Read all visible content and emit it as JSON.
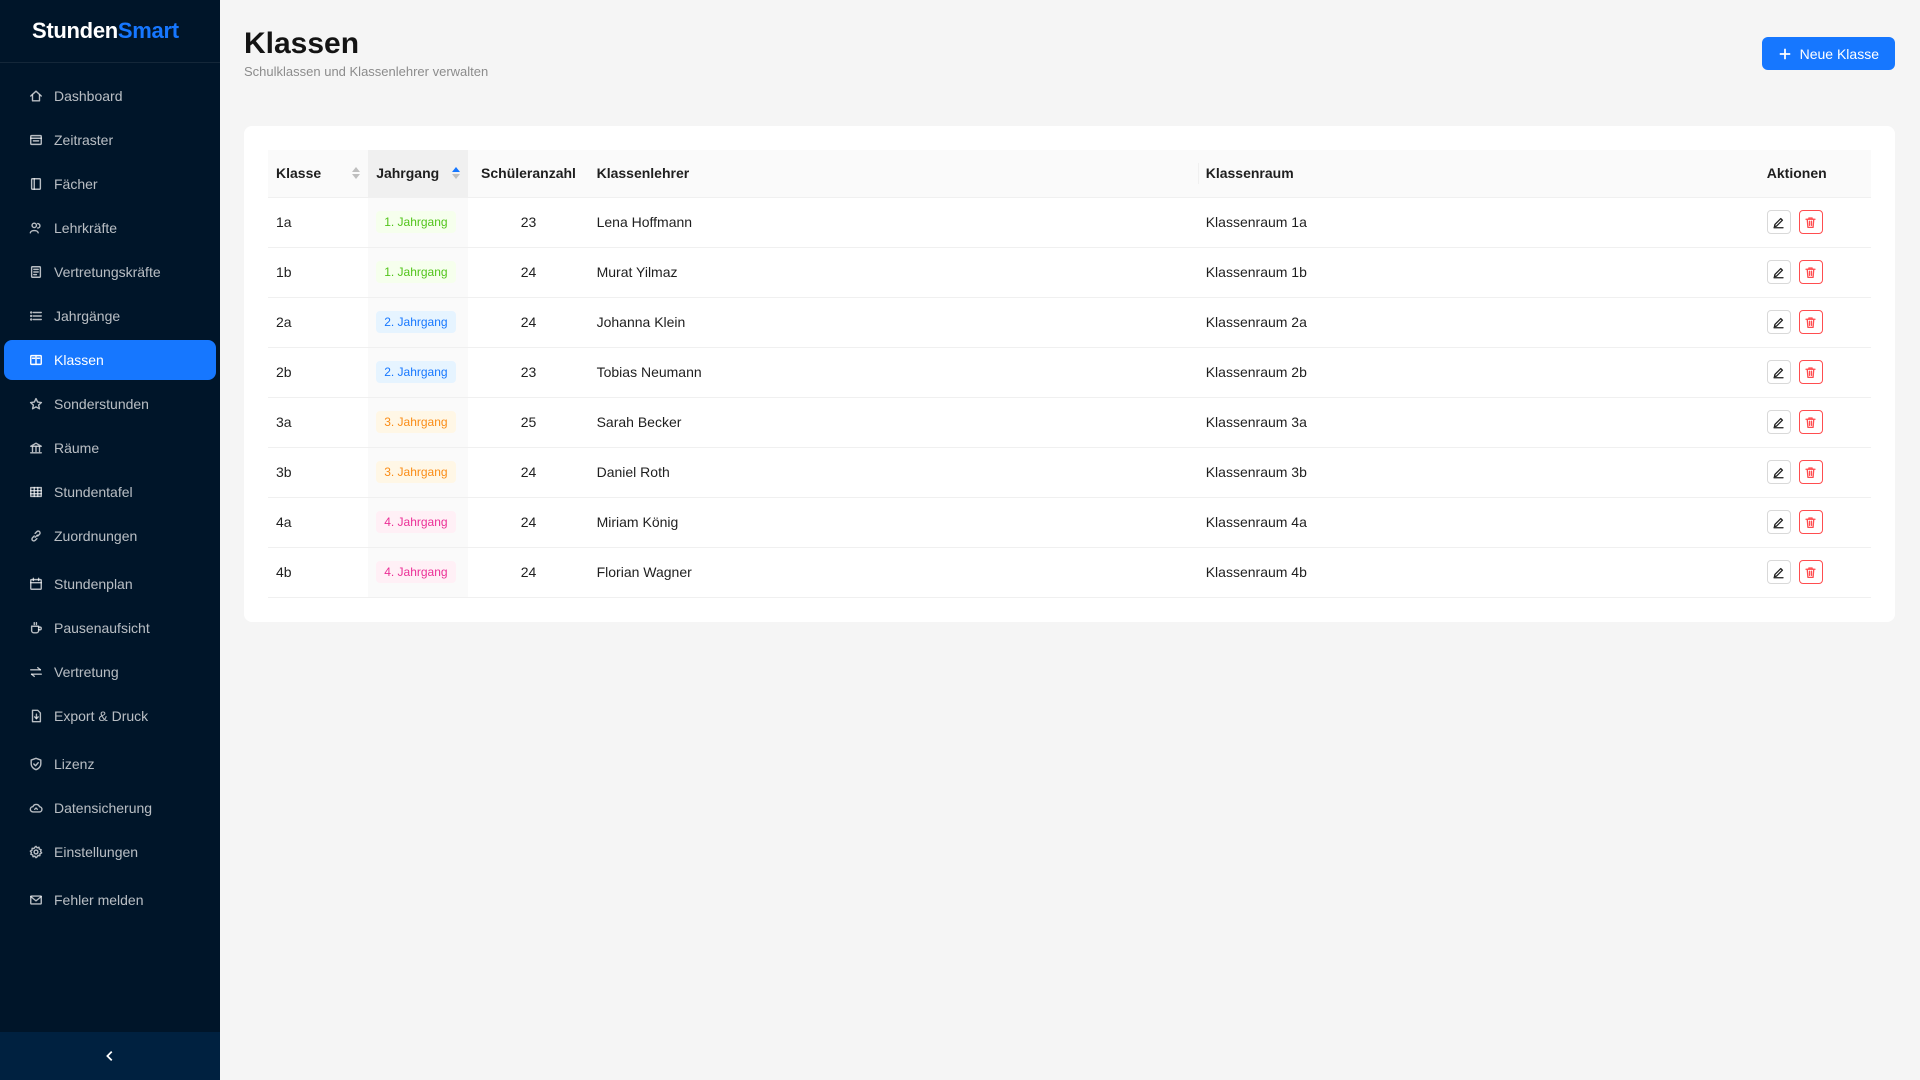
{
  "app": {
    "logo_part1": "Stunden",
    "logo_part2": "Smart"
  },
  "sidebar": {
    "items": [
      {
        "label": "Dashboard",
        "icon": "home-icon"
      },
      {
        "label": "Zeitraster",
        "icon": "clock-grid-icon"
      },
      {
        "label": "Fächer",
        "icon": "book-icon"
      },
      {
        "label": "Lehrkräfte",
        "icon": "users-icon"
      },
      {
        "label": "Vertretungskräfte",
        "icon": "id-card-icon"
      },
      {
        "label": "Jahrgänge",
        "icon": "list-icon"
      },
      {
        "label": "Klassen",
        "icon": "open-book-icon",
        "active": true
      },
      {
        "label": "Sonderstunden",
        "icon": "star-icon"
      },
      {
        "label": "Räume",
        "icon": "bank-icon"
      },
      {
        "label": "Stundentafel",
        "icon": "table-icon"
      },
      {
        "label": "Zuordnungen",
        "icon": "link-icon"
      },
      {
        "label": "Stundenplan",
        "icon": "calendar-icon"
      },
      {
        "label": "Pausenaufsicht",
        "icon": "coffee-icon"
      },
      {
        "label": "Vertretung",
        "icon": "swap-icon"
      },
      {
        "label": "Export & Druck",
        "icon": "file-export-icon"
      },
      {
        "label": "Lizenz",
        "icon": "shield-icon"
      },
      {
        "label": "Datensicherung",
        "icon": "cloud-icon"
      },
      {
        "label": "Einstellungen",
        "icon": "gear-icon"
      },
      {
        "label": "Fehler melden",
        "icon": "mail-icon"
      }
    ]
  },
  "header": {
    "title": "Klassen",
    "subtitle": "Schulklassen und Klassenlehrer verwalten",
    "new_button": "Neue Klasse"
  },
  "table": {
    "columns": [
      "Klasse",
      "Jahrgang",
      "Schüleranzahl",
      "Klassenlehrer",
      "Klassenraum",
      "Aktionen"
    ],
    "sorted_column": "Jahrgang",
    "sort_direction": "ascending",
    "rows": [
      {
        "klasse": "1a",
        "jahrgang": "1. Jahrgang",
        "tag_color": "green",
        "schueler": "23",
        "lehrer": "Lena Hoffmann",
        "raum": "Klassenraum 1a"
      },
      {
        "klasse": "1b",
        "jahrgang": "1. Jahrgang",
        "tag_color": "green",
        "schueler": "24",
        "lehrer": "Murat Yilmaz",
        "raum": "Klassenraum 1b"
      },
      {
        "klasse": "2a",
        "jahrgang": "2. Jahrgang",
        "tag_color": "blue",
        "schueler": "24",
        "lehrer": "Johanna Klein",
        "raum": "Klassenraum 2a"
      },
      {
        "klasse": "2b",
        "jahrgang": "2. Jahrgang",
        "tag_color": "blue",
        "schueler": "23",
        "lehrer": "Tobias Neumann",
        "raum": "Klassenraum 2b"
      },
      {
        "klasse": "3a",
        "jahrgang": "3. Jahrgang",
        "tag_color": "orange",
        "schueler": "25",
        "lehrer": "Sarah Becker",
        "raum": "Klassenraum 3a"
      },
      {
        "klasse": "3b",
        "jahrgang": "3. Jahrgang",
        "tag_color": "orange",
        "schueler": "24",
        "lehrer": "Daniel Roth",
        "raum": "Klassenraum 3b"
      },
      {
        "klasse": "4a",
        "jahrgang": "4. Jahrgang",
        "tag_color": "magenta",
        "schueler": "24",
        "lehrer": "Miriam König",
        "raum": "Klassenraum 4a"
      },
      {
        "klasse": "4b",
        "jahrgang": "4. Jahrgang",
        "tag_color": "magenta",
        "schueler": "24",
        "lehrer": "Florian Wagner",
        "raum": "Klassenraum 4b"
      }
    ]
  },
  "colors": {
    "sidebar_bg": "#001529",
    "accent": "#1677ff",
    "danger": "#ff4d4f"
  }
}
